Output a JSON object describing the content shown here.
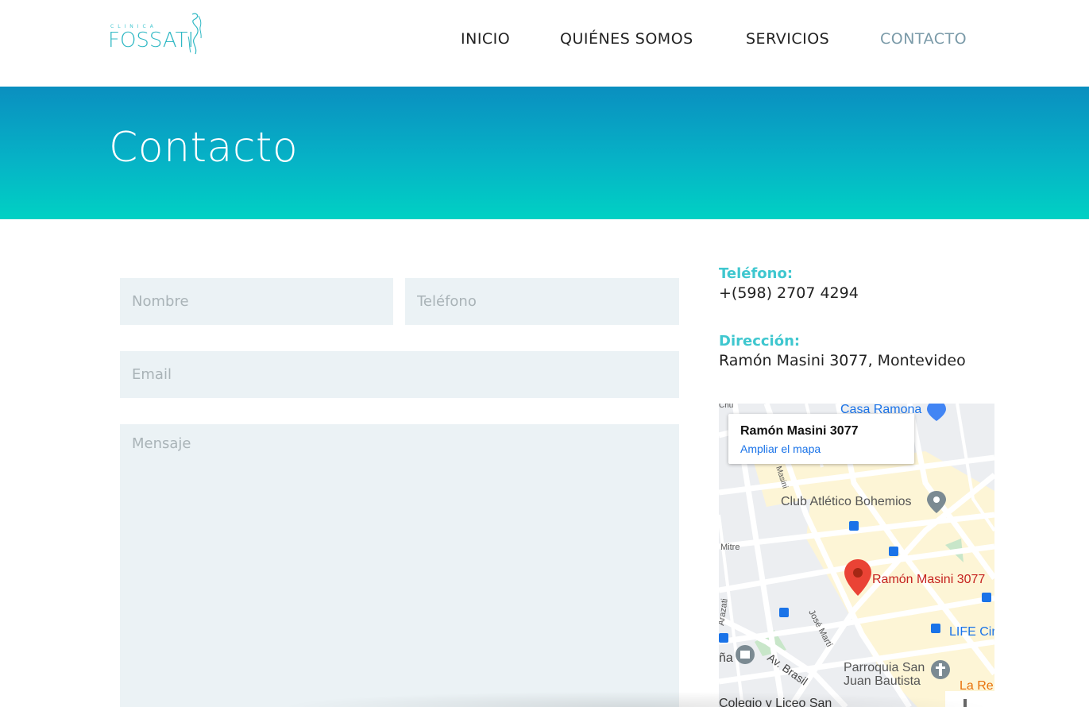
{
  "logo": {
    "small_text": "CLINICA",
    "main_text": "FOSSATI"
  },
  "nav": {
    "items": [
      {
        "label": "INICIO",
        "active": false
      },
      {
        "label": "QUIÉNES SOMOS",
        "active": false
      },
      {
        "label": "SERVICIOS",
        "active": false
      },
      {
        "label": "CONTACTO",
        "active": true
      }
    ]
  },
  "banner": {
    "title": "Contacto"
  },
  "form": {
    "name_placeholder": "Nombre",
    "phone_placeholder": "Teléfono",
    "email_placeholder": "Email",
    "message_placeholder": "Mensaje"
  },
  "info": {
    "phone_label": "Teléfono:",
    "phone_value": "+(598) 2707 4294",
    "address_label": "Dirección:",
    "address_value": "Ramón Masini 3077, Montevideo"
  },
  "map": {
    "card_title": "Ramón Masini 3077",
    "card_link": "Ampliar el mapa",
    "marker_label": "Ramón Masini 3077",
    "places": {
      "casa_ramona": "Casa Ramona",
      "club": "Club Atlético Bohemios",
      "life": "LIFE Cir",
      "parroquia_1": "Parroquia San",
      "parroquia_2": "Juan Bautista",
      "la_re": "La Re",
      "colegio": "Colegio y Liceo San"
    },
    "streets": {
      "mitre": "Mitre",
      "arazati": "Arazati",
      "jose_marti": "José Martí",
      "av_brasil": "Av. Brasil",
      "masini": "Masini",
      "chu": "Chu",
      "na": "ña"
    },
    "colors": {
      "marker": "#ea4335",
      "water_green": "#c8e6c9",
      "road": "#ffffff",
      "block": "#eceef1",
      "highlight": "#fdf5d6"
    }
  }
}
